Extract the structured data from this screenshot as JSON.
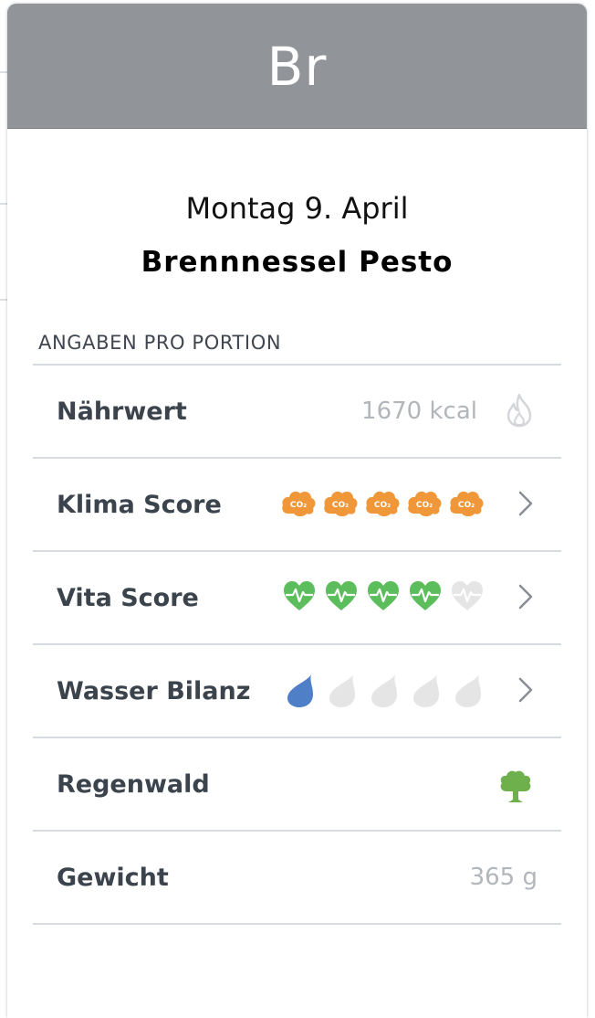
{
  "card": {
    "header_abbr": "Br",
    "date": "Montag 9. April",
    "title": "Brennnessel Pesto",
    "section_label": "ANGABEN PRO PORTION"
  },
  "rows": [
    {
      "label": "Nährwert",
      "value": "1670 kcal",
      "icon": "flame-icon"
    },
    {
      "label": "Klima Score",
      "score": 5,
      "max": 5,
      "icon": "co2-cloud-icon",
      "color": "#f0973a"
    },
    {
      "label": "Vita Score",
      "score": 4,
      "max": 5,
      "icon": "heart-pulse-icon",
      "color": "#5cbd5c"
    },
    {
      "label": "Wasser Bilanz",
      "score": 1,
      "max": 5,
      "icon": "water-drop-icon",
      "color": "#4f7fc6"
    },
    {
      "label": "Regenwald",
      "icon": "tree-icon",
      "color": "#6db04c"
    },
    {
      "label": "Gewicht",
      "value": "365 g"
    }
  ],
  "colors": {
    "header_bg": "#919498",
    "inactive_icon": "#e5e5e5",
    "chevron": "#8a8e94"
  }
}
